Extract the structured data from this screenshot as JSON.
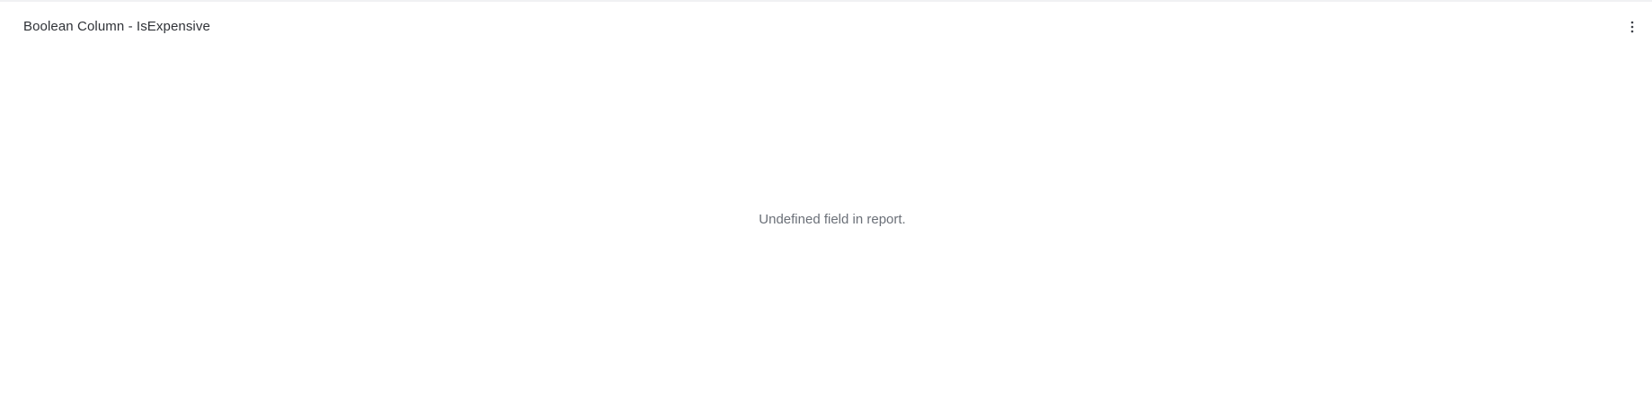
{
  "widget": {
    "title": "Boolean Column - IsExpensive",
    "menu_icon": "more-vertical-icon",
    "empty_message": "Undefined field in report."
  },
  "colors": {
    "title_text": "#2f3237",
    "message_text": "#6b7078",
    "menu_icon": "#3c4047",
    "background": "#ffffff",
    "top_border": "#f0f1f3"
  }
}
